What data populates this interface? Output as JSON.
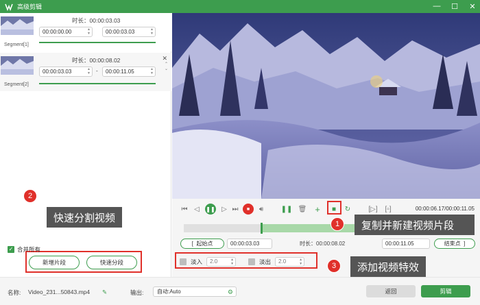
{
  "window": {
    "title": "高级剪辑",
    "minimize": "—",
    "maximize": "☐",
    "close": "✕"
  },
  "segments": [
    {
      "label": "Segment[1]",
      "duration": "时长：00:00:03.03",
      "start": "00:00:00.00",
      "end": "00:00:03.03"
    },
    {
      "label": "Segment[2]",
      "duration": "时长：00:00:08.02",
      "start": "00:00:03.03",
      "end": "00:00:11.05",
      "separator": "-"
    }
  ],
  "left_actions": {
    "add_segment": "新增片段",
    "quick_split": "快速分段",
    "merge_all": "合并所有"
  },
  "player": {
    "time_display": "00:00:06.17/00:00:11.05",
    "start_point_label": "起始点",
    "start_value": "00:00:03.03",
    "duration_label": "时长：00:00:08.02",
    "end_value": "00:00:11.05",
    "end_point_label": "结束点",
    "fade_in_label": "淡入",
    "fade_in_value": "2.0",
    "fade_out_label": "淡出",
    "fade_out_value": "2.0"
  },
  "bottom": {
    "name_label": "名称:",
    "filename": "Video_231...50843.mp4",
    "output_label": "输出:",
    "output_value": "自动:Auto",
    "back_button": "返回",
    "edit_button": "剪辑"
  },
  "annotations": [
    {
      "num": "1",
      "text": "复制并新建视频片段"
    },
    {
      "num": "2",
      "text": "快速分割视频"
    },
    {
      "num": "3",
      "text": "添加视频特效"
    }
  ],
  "colors": {
    "accent": "#3d9d4e",
    "highlight": "#e0302a",
    "callout": "#555555"
  }
}
